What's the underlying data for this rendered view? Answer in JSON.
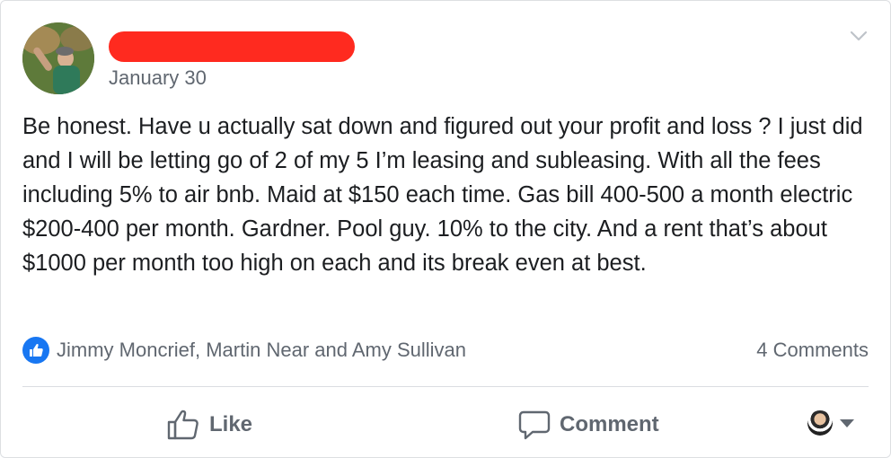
{
  "post": {
    "date": "January 30",
    "body": "Be honest. Have u actually sat down and figured out your profit and loss ? I just did and I will be letting go of 2 of my 5 I’m leasing and subleasing. With all the fees including 5% to air bnb. Maid at $150 each time. Gas bill 400-500 a month electric $200-400 per month. Gardner. Pool guy. 10% to the city. And a rent that’s about $1000 per month too high on each and its break even at best."
  },
  "reactions": {
    "likers": "Jimmy Moncrief, Martin Near and Amy Sullivan",
    "comments_count": "4 Comments"
  },
  "actions": {
    "like_label": "Like",
    "comment_label": "Comment"
  },
  "icons": {
    "options": "chevron-down-icon",
    "like_badge": "thumbs-up-icon",
    "like": "thumbs-up-outline-icon",
    "comment": "speech-bubble-icon",
    "reactor_menu": "caret-down-icon"
  },
  "colors": {
    "accent": "#1877f2",
    "redaction": "#ff2a1f",
    "secondary_text": "#606770",
    "primary_text": "#1c1e21"
  }
}
